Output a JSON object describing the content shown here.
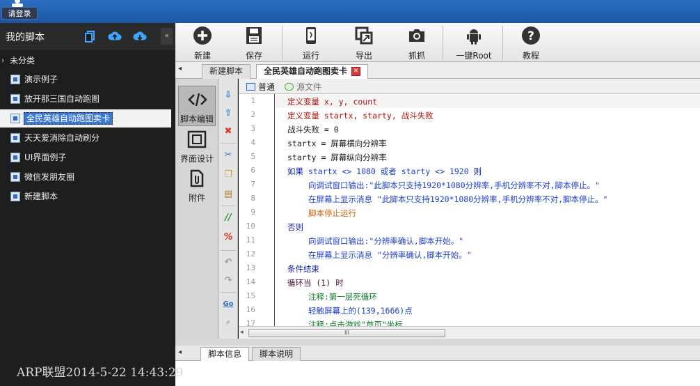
{
  "topbar": {
    "login_label": "请登录"
  },
  "sidebar": {
    "title": "我的脚本",
    "collapse_glyph": "«",
    "category": "未分类",
    "category_arrow": "›",
    "items": [
      {
        "label": "演示例子"
      },
      {
        "label": "放开那三国自动跑图"
      },
      {
        "label": "全民英雄自动跑图卖卡"
      },
      {
        "label": "天天爱消除自动刷分"
      },
      {
        "label": "UI界面例子"
      },
      {
        "label": "微信发朋友圈"
      },
      {
        "label": "新建脚本"
      }
    ]
  },
  "watermark": "ARP联盟2014-5-22 14:43:29",
  "toolbar": {
    "buttons": [
      {
        "label": "新建",
        "icon": "plus-circle-icon"
      },
      {
        "label": "保存",
        "icon": "floppy-icon"
      },
      {
        "label": "运行",
        "icon": "phone-run-icon"
      },
      {
        "label": "导出",
        "icon": "export-icon"
      },
      {
        "label": "抓抓",
        "icon": "camera-icon"
      },
      {
        "label": "一键Root",
        "icon": "android-icon"
      },
      {
        "label": "教程",
        "icon": "help-icon"
      }
    ]
  },
  "tabs": [
    {
      "label": "新建脚本"
    },
    {
      "label": "全民英雄自动跑图卖卡"
    }
  ],
  "tab_close_glyph": "✕",
  "tab_arrow": "◂",
  "mode_panel": [
    {
      "label": "脚本编辑"
    },
    {
      "label": "界面设计"
    },
    {
      "label": "附件"
    }
  ],
  "editor_tabs": [
    {
      "label": "普通"
    },
    {
      "label": "源文件"
    }
  ],
  "code_lines": [
    {
      "n": "1",
      "indent": 0,
      "parts": [
        [
          "kw-red",
          "定义变量 x, y, count"
        ]
      ]
    },
    {
      "n": "2",
      "indent": 0,
      "parts": [
        [
          "kw-red",
          "定义变量 startx, starty, 战斗失败"
        ]
      ]
    },
    {
      "n": "3",
      "indent": 0,
      "parts": [
        [
          "plain",
          "战斗失败 = 0"
        ]
      ]
    },
    {
      "n": "4",
      "indent": 0,
      "parts": [
        [
          "plain",
          "startx = 屏幕横向分辨率"
        ]
      ]
    },
    {
      "n": "5",
      "indent": 0,
      "parts": [
        [
          "plain",
          "starty = 屏幕纵向分辨率"
        ]
      ]
    },
    {
      "n": "6",
      "indent": 0,
      "parts": [
        [
          "kw",
          "如果 "
        ],
        [
          "blue",
          "startx <> 1080 或者 starty <> 1920 "
        ],
        [
          "kw",
          "则"
        ]
      ]
    },
    {
      "n": "7",
      "indent": 1,
      "parts": [
        [
          "blue",
          "向调试窗口输出:\"此脚本只支持1920*1080分辨率,手机分辨率不对,脚本停止。\""
        ]
      ]
    },
    {
      "n": "8",
      "indent": 1,
      "parts": [
        [
          "blue",
          "在屏幕上显示消息 \"此脚本只支持1920*1080分辨率,手机分辨率不对,脚本停止。\""
        ]
      ]
    },
    {
      "n": "9",
      "indent": 1,
      "parts": [
        [
          "kw-orange",
          "脚本停止运行"
        ]
      ]
    },
    {
      "n": "10",
      "indent": 0,
      "parts": [
        [
          "kw",
          "否则"
        ]
      ]
    },
    {
      "n": "11",
      "indent": 1,
      "parts": [
        [
          "blue",
          "向调试窗口输出:\"分辨率确认,脚本开始。\""
        ]
      ]
    },
    {
      "n": "12",
      "indent": 1,
      "parts": [
        [
          "blue",
          "在屏幕上显示消息 \"分辨率确认,脚本开始。\""
        ]
      ]
    },
    {
      "n": "13",
      "indent": 0,
      "parts": [
        [
          "kw",
          "条件结束"
        ]
      ]
    },
    {
      "n": "14",
      "indent": 0,
      "parts": [
        [
          "kw-dark",
          "循环当 (1) 时"
        ]
      ]
    },
    {
      "n": "15",
      "indent": 1,
      "parts": [
        [
          "kw-green",
          "注释:第一层死循环"
        ]
      ]
    },
    {
      "n": "16",
      "indent": 1,
      "parts": [
        [
          "blue",
          "轻触屏幕上的(139,1666)点"
        ]
      ]
    },
    {
      "n": "17",
      "indent": 1,
      "parts": [
        [
          "kw-green",
          "注释:点击游戏\"首页\"坐标"
        ]
      ]
    }
  ],
  "scroll_thumb_glyph": "III",
  "scroll_left_glyph": "◂",
  "bottom_tabs": [
    {
      "label": "脚本信息"
    },
    {
      "label": "脚本说明"
    }
  ],
  "colors": {
    "topbar": "#1b56a3",
    "selection": "#3a78d4",
    "sidebar_bg": "#1e1e1e"
  }
}
